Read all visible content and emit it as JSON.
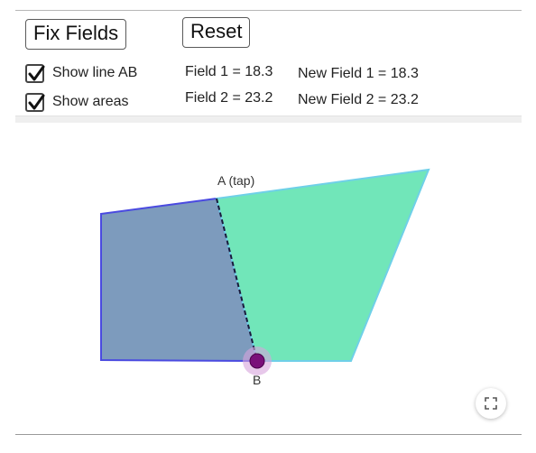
{
  "controls": {
    "fix_fields_label": "Fix Fields",
    "reset_label": "Reset",
    "show_line_label": "Show line AB",
    "show_line_checked": true,
    "show_areas_label": "Show areas",
    "show_areas_checked": true
  },
  "stats": {
    "field1": "Field 1 = 18.3",
    "field2": "Field 2 = 23.2",
    "new_field1": "New Field 1 = 18.3",
    "new_field2": "New Field 2 = 23.2"
  },
  "geometry": {
    "point_a_label": "A (tap)",
    "point_b_label": "B",
    "field1_color": "#7d9bbd",
    "field2_color": "#71e6b9",
    "field1_stroke": "#4a4ae0",
    "field2_stroke": "#6fd0e8",
    "point_b_color": "#7a0f7a",
    "line_ab_style": "dashed"
  },
  "icons": {
    "checkbox": "checkmark-icon",
    "fullscreen": "fullscreen-icon"
  }
}
